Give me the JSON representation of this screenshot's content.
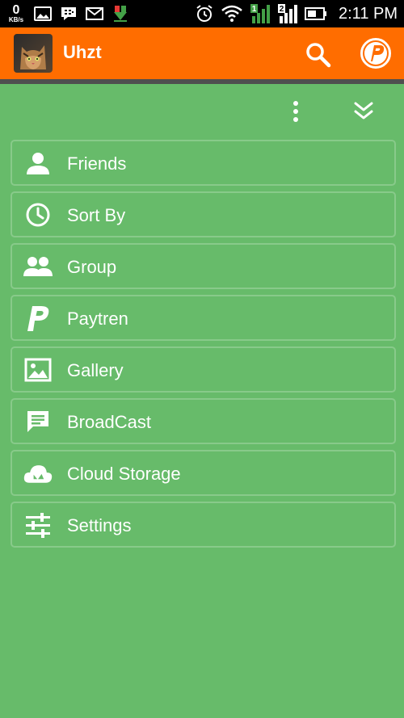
{
  "status_bar": {
    "data_rate_value": "0",
    "data_rate_unit": "KB/s",
    "sim1_label": "1",
    "sim2_label": "2",
    "time": "2:11 PM",
    "left_icons": [
      "gallery-icon",
      "bbm-icon",
      "mail-icon",
      "download-icon"
    ],
    "right_icons": [
      "alarm-icon",
      "wifi-icon",
      "signal-sim1-icon",
      "signal-sim2-icon",
      "battery-icon"
    ]
  },
  "app_bar": {
    "title": "Uhzt",
    "color": "#ff6d00",
    "actions": [
      "search-icon",
      "paytren-logo-icon"
    ]
  },
  "toolbar": {
    "actions": [
      "more-vertical-icon",
      "double-chevron-down-icon"
    ]
  },
  "menu": {
    "background": "#67bb6a",
    "items": [
      {
        "label": "Friends",
        "icon": "person-icon"
      },
      {
        "label": "Sort By",
        "icon": "clock-icon"
      },
      {
        "label": "Group",
        "icon": "group-icon"
      },
      {
        "label": "Paytren",
        "icon": "paytren-p-icon"
      },
      {
        "label": "Gallery",
        "icon": "image-icon"
      },
      {
        "label": "BroadCast",
        "icon": "chat-icon"
      },
      {
        "label": "Cloud Storage",
        "icon": "cloud-icon"
      },
      {
        "label": "Settings",
        "icon": "sliders-icon"
      }
    ]
  }
}
